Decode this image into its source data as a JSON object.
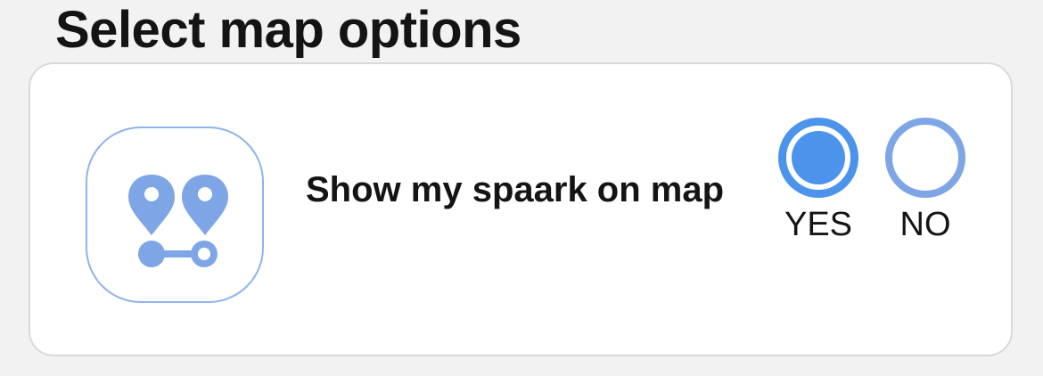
{
  "page": {
    "title": "Select map options"
  },
  "map_options": {
    "show_on_map": {
      "label": "Show my spaark on map",
      "icon": "map-route-pins-icon",
      "selected": "yes",
      "options": [
        {
          "value": "yes",
          "label": "YES"
        },
        {
          "value": "no",
          "label": "NO"
        }
      ]
    }
  },
  "colors": {
    "background": "#f2f2f2",
    "card": "#ffffff",
    "accent": "#4b93eb",
    "icon": "#7ea6e6",
    "text": "#141414"
  }
}
